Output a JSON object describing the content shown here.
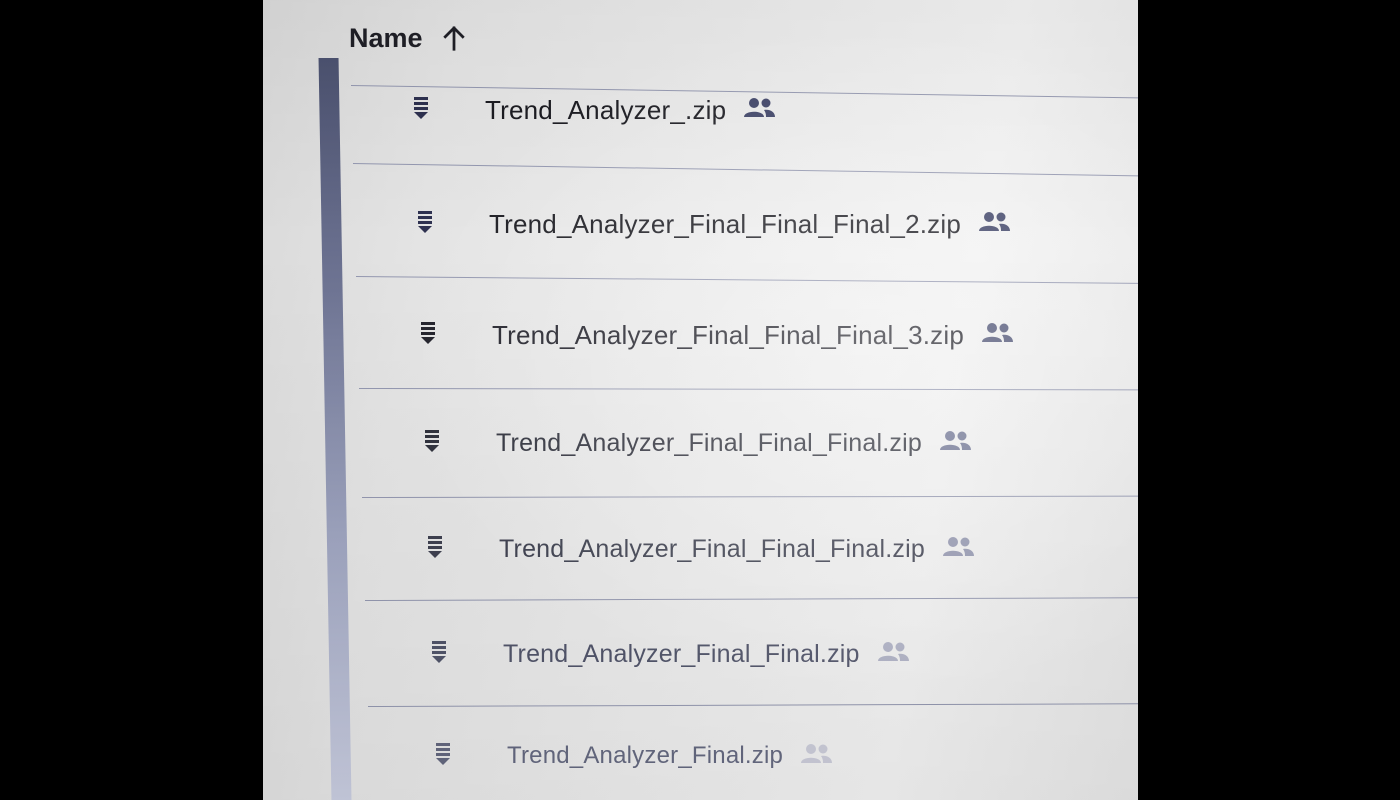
{
  "header": {
    "name_label": "Name",
    "sort_icon": "arrow-up-icon"
  },
  "files": [
    {
      "name": "Trend_Analyzer_.zip",
      "icon": "zip-file-icon",
      "shared_icon": "shared-people-icon"
    },
    {
      "name": "Trend_Analyzer_Final_Final_Final_2.zip",
      "icon": "zip-file-icon",
      "shared_icon": "shared-people-icon"
    },
    {
      "name": "Trend_Analyzer_Final_Final_Final_3.zip",
      "icon": "zip-file-icon",
      "shared_icon": "shared-people-icon"
    },
    {
      "name": "Trend_Analyzer_Final_Final_Final.zip",
      "icon": "zip-file-icon",
      "shared_icon": "shared-people-icon"
    },
    {
      "name": "Trend_Analyzer_Final_Final_Final.zip",
      "icon": "zip-file-icon",
      "shared_icon": "shared-people-icon"
    },
    {
      "name": "Trend_Analyzer_Final_Final.zip",
      "icon": "zip-file-icon",
      "shared_icon": "shared-people-icon"
    },
    {
      "name": "Trend_Analyzer_Final.zip",
      "icon": "zip-file-icon",
      "shared_icon": "shared-people-icon"
    }
  ],
  "colors": {
    "text_dark": "#1f1f26",
    "icon_blue": "#3a3f63",
    "divider": "#9498b0"
  }
}
